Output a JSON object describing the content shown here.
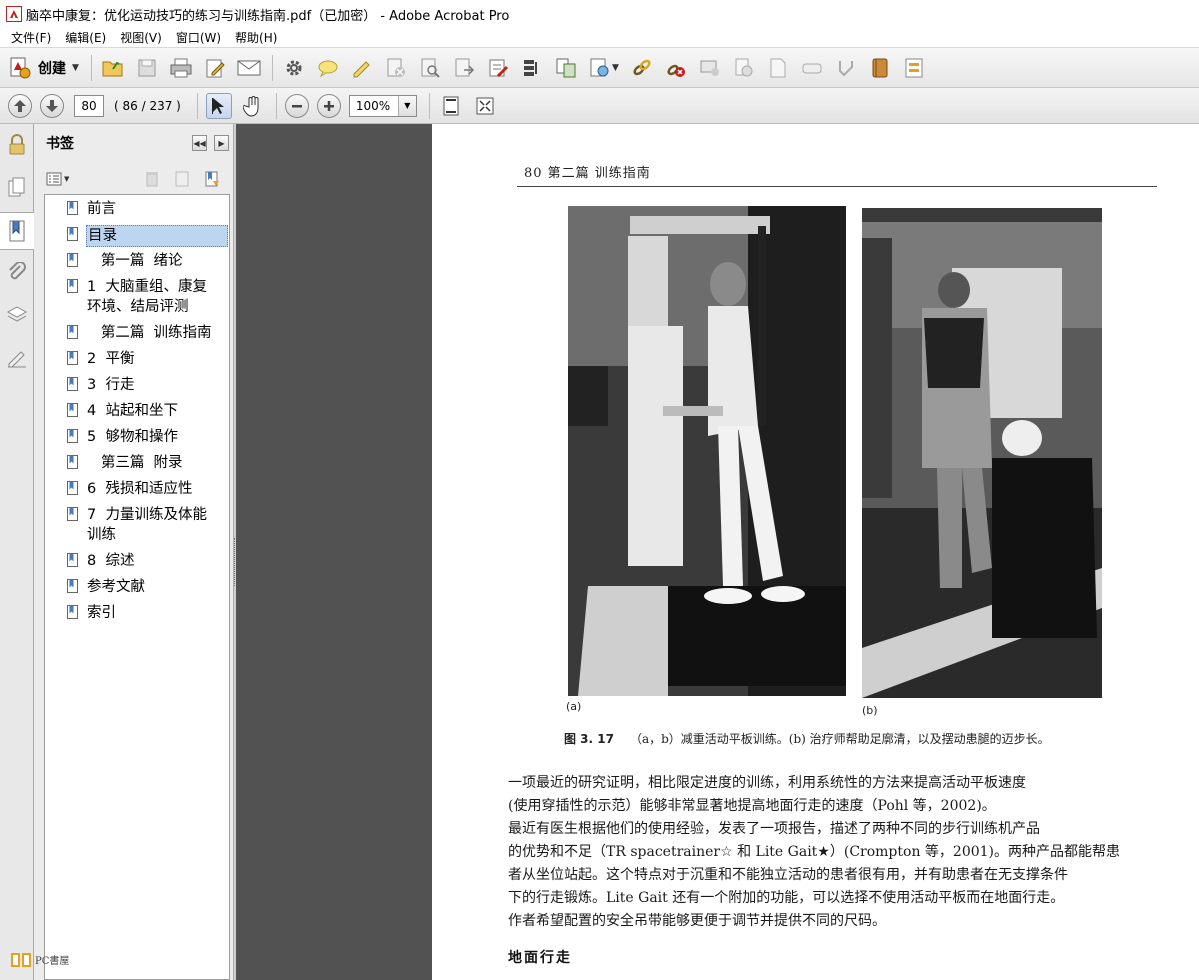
{
  "window": {
    "title": "脑卒中康复：优化运动技巧的练习与训练指南.pdf（已加密） - Adobe Acrobat Pro"
  },
  "menu": [
    "文件(F)",
    "编辑(E)",
    "视图(V)",
    "窗口(W)",
    "帮助(H)"
  ],
  "toolbar": {
    "create_label": "创建"
  },
  "nav": {
    "page_value": "80",
    "page_count": "( 86 / 237 )",
    "zoom_value": "100%"
  },
  "panel": {
    "title": "书签"
  },
  "bookmarks": [
    {
      "label": "前言",
      "selected": false
    },
    {
      "label": "目录",
      "selected": true
    },
    {
      "label": "   第一篇  绪论",
      "selected": false
    },
    {
      "label": "1  大脑重组、康复\n环境、结局评测",
      "selected": false
    },
    {
      "label": "   第二篇  训练指南",
      "selected": false
    },
    {
      "label": "2  平衡",
      "selected": false
    },
    {
      "label": "3  行走",
      "selected": false
    },
    {
      "label": "4  站起和坐下",
      "selected": false
    },
    {
      "label": "5  够物和操作",
      "selected": false
    },
    {
      "label": "   第三篇  附录",
      "selected": false
    },
    {
      "label": "6  残损和适应性",
      "selected": false
    },
    {
      "label": "7  力量训练及体能\n训练",
      "selected": false
    },
    {
      "label": "8  综述",
      "selected": false
    },
    {
      "label": "参考文献",
      "selected": false
    },
    {
      "label": "索引",
      "selected": false
    }
  ],
  "document": {
    "running_head": "80  第二篇  训练指南",
    "photo_a_label": "(a)",
    "photo_b_label": "(b)",
    "caption_num": "图 3. 17",
    "caption_text": "（a，b）减重活动平板训练。(b) 治疗师帮助足廓清，以及摆动患腿的迈步长。",
    "para1": [
      "    一项最近的研究证明，相比限定进度的训练，利用系统性的方法来提高活动平板速度",
      "(使用穿插性的示范）能够非常显著地提高地面行走的速度（Pohl 等，2002)。"
    ],
    "para2": [
      "    最近有医生根据他们的使用经验，发表了一项报告，描述了两种不同的步行训练机产品",
      "的优势和不足（TR spacetrainer☆ 和 Lite Gait★）(Crompton 等，2001)。两种产品都能帮患",
      "者从坐位站起。这个特点对于沉重和不能独立活动的患者很有用，并有助患者在无支撑条件",
      "下的行走锻炼。Lite Gait 还有一个附加的功能，可以选择不使用活动平板而在地面行走。",
      "作者希望配置的安全吊带能够更便于调节并提供不同的尺码。"
    ],
    "subhead": "地面行走"
  },
  "watermark": {
    "text": "PC書屋"
  }
}
